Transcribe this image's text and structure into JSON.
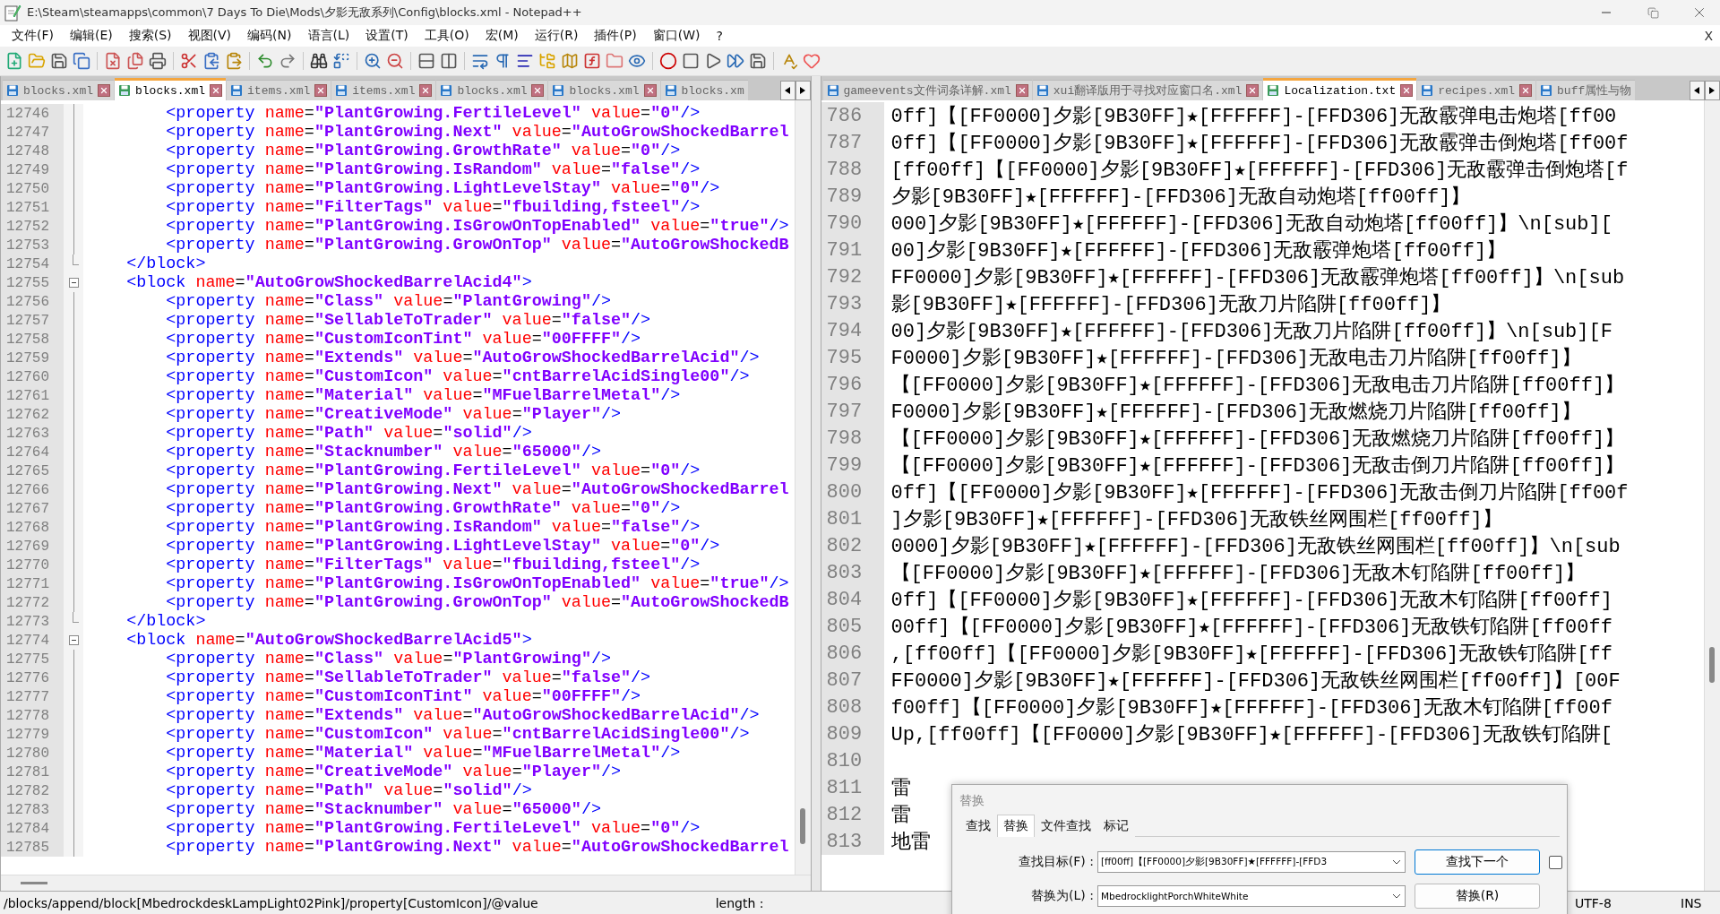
{
  "window": {
    "title": "E:\\Steam\\steamapps\\common\\7 Days To Die\\Mods\\夕影无敌系列\\Config\\blocks.xml - Notepad++"
  },
  "menu": [
    "文件(F)",
    "编辑(E)",
    "搜索(S)",
    "视图(V)",
    "编码(N)",
    "语言(L)",
    "设置(T)",
    "工具(O)",
    "宏(M)",
    "运行(R)",
    "插件(P)",
    "窗口(W)",
    "?"
  ],
  "menu_close": "X",
  "left_pane": {
    "tabs": [
      {
        "label": "blocks.xml",
        "selected": false,
        "close_button": true
      },
      {
        "label": "blocks.xml",
        "selected": true,
        "close_button": true
      },
      {
        "label": "items.xml",
        "selected": false,
        "close_button": true
      },
      {
        "label": "items.xml",
        "selected": false,
        "close_button": true
      },
      {
        "label": "blocks.xml",
        "selected": false,
        "close_button": true
      },
      {
        "label": "blocks.xml",
        "selected": false,
        "close_button": true
      },
      {
        "label": "blocks.xm",
        "selected": false,
        "close_button": false
      }
    ],
    "lines": [
      {
        "number": "12746",
        "kind": "inside",
        "text": "        <property name=\"PlantGrowing.FertileLevel\" value=\"0\"/>"
      },
      {
        "number": "12747",
        "kind": "inside",
        "text": "        <property name=\"PlantGrowing.Next\" value=\"AutoGrowShockedBarrel"
      },
      {
        "number": "12748",
        "kind": "inside",
        "text": "        <property name=\"PlantGrowing.GrowthRate\" value=\"0\"/>"
      },
      {
        "number": "12749",
        "kind": "inside",
        "text": "        <property name=\"PlantGrowing.IsRandom\" value=\"false\"/>"
      },
      {
        "number": "12750",
        "kind": "inside",
        "text": "        <property name=\"PlantGrowing.LightLevelStay\" value=\"0\"/>"
      },
      {
        "number": "12751",
        "kind": "inside",
        "text": "        <property name=\"FilterTags\" value=\"fbuilding,fsteel\"/>"
      },
      {
        "number": "12752",
        "kind": "inside",
        "text": "        <property name=\"PlantGrowing.IsGrowOnTopEnabled\" value=\"true\"/>"
      },
      {
        "number": "12753",
        "kind": "inside",
        "text": "        <property name=\"PlantGrowing.GrowOnTop\" value=\"AutoGrowShockedB"
      },
      {
        "number": "12754",
        "kind": "end",
        "text": "    </block>"
      },
      {
        "number": "12755",
        "kind": "start",
        "text": "    <block name=\"AutoGrowShockedBarrelAcid4\">"
      },
      {
        "number": "12756",
        "kind": "inside",
        "text": "        <property name=\"Class\" value=\"PlantGrowing\"/>"
      },
      {
        "number": "12757",
        "kind": "inside",
        "text": "        <property name=\"SellableToTrader\" value=\"false\"/>"
      },
      {
        "number": "12758",
        "kind": "inside",
        "text": "        <property name=\"CustomIconTint\" value=\"00FFFF\"/>"
      },
      {
        "number": "12759",
        "kind": "inside",
        "text": "        <property name=\"Extends\" value=\"AutoGrowShockedBarrelAcid\"/>"
      },
      {
        "number": "12760",
        "kind": "inside",
        "text": "        <property name=\"CustomIcon\" value=\"cntBarrelAcidSingle00\"/>"
      },
      {
        "number": "12761",
        "kind": "inside",
        "text": "        <property name=\"Material\" value=\"MFuelBarrelMetal\"/>"
      },
      {
        "number": "12762",
        "kind": "inside",
        "text": "        <property name=\"CreativeMode\" value=\"Player\"/>"
      },
      {
        "number": "12763",
        "kind": "inside",
        "text": "        <property name=\"Path\" value=\"solid\"/>"
      },
      {
        "number": "12764",
        "kind": "inside",
        "text": "        <property name=\"Stacknumber\" value=\"65000\"/>"
      },
      {
        "number": "12765",
        "kind": "inside",
        "text": "        <property name=\"PlantGrowing.FertileLevel\" value=\"0\"/>"
      },
      {
        "number": "12766",
        "kind": "inside",
        "text": "        <property name=\"PlantGrowing.Next\" value=\"AutoGrowShockedBarrel"
      },
      {
        "number": "12767",
        "kind": "inside",
        "text": "        <property name=\"PlantGrowing.GrowthRate\" value=\"0\"/>"
      },
      {
        "number": "12768",
        "kind": "inside",
        "text": "        <property name=\"PlantGrowing.IsRandom\" value=\"false\"/>"
      },
      {
        "number": "12769",
        "kind": "inside",
        "text": "        <property name=\"PlantGrowing.LightLevelStay\" value=\"0\"/>"
      },
      {
        "number": "12770",
        "kind": "inside",
        "text": "        <property name=\"FilterTags\" value=\"fbuilding,fsteel\"/>"
      },
      {
        "number": "12771",
        "kind": "inside",
        "text": "        <property name=\"PlantGrowing.IsGrowOnTopEnabled\" value=\"true\"/>"
      },
      {
        "number": "12772",
        "kind": "inside",
        "text": "        <property name=\"PlantGrowing.GrowOnTop\" value=\"AutoGrowShockedB"
      },
      {
        "number": "12773",
        "kind": "end",
        "text": "    </block>"
      },
      {
        "number": "12774",
        "kind": "start",
        "text": "    <block name=\"AutoGrowShockedBarrelAcid5\">"
      },
      {
        "number": "12775",
        "kind": "inside",
        "text": "        <property name=\"Class\" value=\"PlantGrowing\"/>"
      },
      {
        "number": "12776",
        "kind": "inside",
        "text": "        <property name=\"SellableToTrader\" value=\"false\"/>"
      },
      {
        "number": "12777",
        "kind": "inside",
        "text": "        <property name=\"CustomIconTint\" value=\"00FFFF\"/>"
      },
      {
        "number": "12778",
        "kind": "inside",
        "text": "        <property name=\"Extends\" value=\"AutoGrowShockedBarrelAcid\"/>"
      },
      {
        "number": "12779",
        "kind": "inside",
        "text": "        <property name=\"CustomIcon\" value=\"cntBarrelAcidSingle00\"/>"
      },
      {
        "number": "12780",
        "kind": "inside",
        "text": "        <property name=\"Material\" value=\"MFuelBarrelMetal\"/>"
      },
      {
        "number": "12781",
        "kind": "inside",
        "text": "        <property name=\"CreativeMode\" value=\"Player\"/>"
      },
      {
        "number": "12782",
        "kind": "inside",
        "text": "        <property name=\"Path\" value=\"solid\"/>"
      },
      {
        "number": "12783",
        "kind": "inside",
        "text": "        <property name=\"Stacknumber\" value=\"65000\"/>"
      },
      {
        "number": "12784",
        "kind": "inside",
        "text": "        <property name=\"PlantGrowing.FertileLevel\" value=\"0\"/>"
      },
      {
        "number": "12785",
        "kind": "inside",
        "text": "        <property name=\"PlantGrowing.Next\" value=\"AutoGrowShockedBarrel"
      }
    ]
  },
  "right_pane": {
    "tabs": [
      {
        "label": "gameevents文件词条详解.xml",
        "selected": false,
        "close_button": true
      },
      {
        "label": "xui翻译版用于寻找对应窗口名.xml",
        "selected": false,
        "close_button": true
      },
      {
        "label": "Localization.txt",
        "selected": true,
        "close_button": true
      },
      {
        "label": "recipes.xml",
        "selected": false,
        "close_button": true
      },
      {
        "label": "buff属性与物",
        "selected": false,
        "close_button": false
      }
    ],
    "lines": [
      {
        "number": "786",
        "text": "0ff]【[FF0000]夕影[9B30FF]★[FFFFFF]-[FFD306]无敌霰弹电击炮塔[ff00"
      },
      {
        "number": "787",
        "text": "0ff]【[FF0000]夕影[9B30FF]★[FFFFFF]-[FFD306]无敌霰弹击倒炮塔[ff00f"
      },
      {
        "number": "788",
        "text": "[ff00ff]【[FF0000]夕影[9B30FF]★[FFFFFF]-[FFD306]无敌霰弹击倒炮塔[f"
      },
      {
        "number": "789",
        "text": "夕影[9B30FF]★[FFFFFF]-[FFD306]无敌自动炮塔[ff00ff]】"
      },
      {
        "number": "790",
        "text": "000]夕影[9B30FF]★[FFFFFF]-[FFD306]无敌自动炮塔[ff00ff]】\\n[sub]["
      },
      {
        "number": "791",
        "text": "00]夕影[9B30FF]★[FFFFFF]-[FFD306]无敌霰弹炮塔[ff00ff]】"
      },
      {
        "number": "792",
        "text": "FF0000]夕影[9B30FF]★[FFFFFF]-[FFD306]无敌霰弹炮塔[ff00ff]】\\n[sub"
      },
      {
        "number": "793",
        "text": "影[9B30FF]★[FFFFFF]-[FFD306]无敌刀片陷阱[ff00ff]】"
      },
      {
        "number": "794",
        "text": "00]夕影[9B30FF]★[FFFFFF]-[FFD306]无敌刀片陷阱[ff00ff]】\\n[sub][F"
      },
      {
        "number": "795",
        "text": "F0000]夕影[9B30FF]★[FFFFFF]-[FFD306]无敌电击刀片陷阱[ff00ff]】"
      },
      {
        "number": "796",
        "text": "【[FF0000]夕影[9B30FF]★[FFFFFF]-[FFD306]无敌电击刀片陷阱[ff00ff]】"
      },
      {
        "number": "797",
        "text": "F0000]夕影[9B30FF]★[FFFFFF]-[FFD306]无敌燃烧刀片陷阱[ff00ff]】"
      },
      {
        "number": "798",
        "text": "【[FF0000]夕影[9B30FF]★[FFFFFF]-[FFD306]无敌燃烧刀片陷阱[ff00ff]】"
      },
      {
        "number": "799",
        "text": "【[FF0000]夕影[9B30FF]★[FFFFFF]-[FFD306]无敌击倒刀片陷阱[ff00ff]】"
      },
      {
        "number": "800",
        "text": "0ff]【[FF0000]夕影[9B30FF]★[FFFFFF]-[FFD306]无敌击倒刀片陷阱[ff00f"
      },
      {
        "number": "801",
        "text": "]夕影[9B30FF]★[FFFFFF]-[FFD306]无敌铁丝网围栏[ff00ff]】"
      },
      {
        "number": "802",
        "text": "0000]夕影[9B30FF]★[FFFFFF]-[FFD306]无敌铁丝网围栏[ff00ff]】\\n[sub"
      },
      {
        "number": "803",
        "text": "【[FF0000]夕影[9B30FF]★[FFFFFF]-[FFD306]无敌木钉陷阱[ff00ff]】"
      },
      {
        "number": "804",
        "text": "0ff]【[FF0000]夕影[9B30FF]★[FFFFFF]-[FFD306]无敌木钉陷阱[ff00ff]"
      },
      {
        "number": "805",
        "text": "00ff]【[FF0000]夕影[9B30FF]★[FFFFFF]-[FFD306]无敌铁钉陷阱[ff00ff"
      },
      {
        "number": "806",
        "text": ",[ff00ff]【[FF0000]夕影[9B30FF]★[FFFFFF]-[FFD306]无敌铁钉陷阱[ff"
      },
      {
        "number": "807",
        "text": "FF0000]夕影[9B30FF]★[FFFFFF]-[FFD306]无敌铁丝网围栏[ff00ff]】[00F"
      },
      {
        "number": "808",
        "text": "f00ff]【[FF0000]夕影[9B30FF]★[FFFFFF]-[FFD306]无敌木钉陷阱[ff00f"
      },
      {
        "number": "809",
        "text": "Up,[ff00ff]【[FF0000]夕影[9B30FF]★[FFFFFF]-[FFD306]无敌铁钉陷阱["
      },
      {
        "number": "810"
      },
      {
        "number": "811",
        "text": "雷"
      },
      {
        "number": "812",
        "text": "雷"
      },
      {
        "number": "813",
        "text": "地雷"
      }
    ]
  },
  "replace_dialog": {
    "title": "替换",
    "tabs": [
      {
        "label": "查找",
        "selected": false
      },
      {
        "label": "替换",
        "selected": true
      },
      {
        "label": "文件查找",
        "selected": false
      },
      {
        "label": "标记",
        "selected": false
      }
    ],
    "fields": [
      {
        "label": "查找目标(F) :",
        "value": "[ff00ff]【[FF0000]夕影[9B30FF]★[FFFFFF]-[FFD3"
      },
      {
        "label": "替换为(L) :",
        "value": "MbedrocklightPorchWhiteWhite"
      }
    ],
    "buttons": [
      "查找下一个",
      "替换(R)"
    ],
    "checkbox": {
      "checked": false
    }
  },
  "status_bar": {
    "path": "/blocks/append/block[MbedrockdeskLampLight02Pink]/property[CustomIcon]/@value",
    "length": "length :",
    "encoding": "UTF-8",
    "mode": "INS"
  }
}
